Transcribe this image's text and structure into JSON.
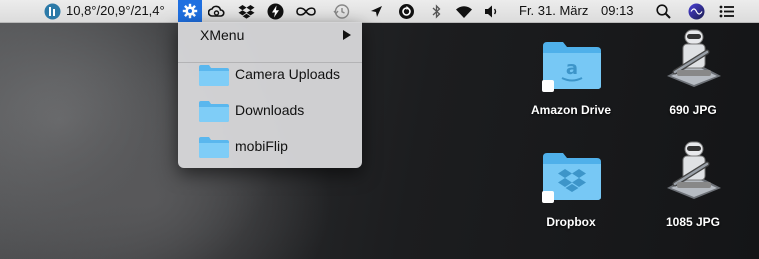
{
  "menubar": {
    "weather_text": "10,8°/20,9°/21,4°",
    "date": "Fr. 31. März",
    "time": "09:13",
    "status_icons": [
      "weather-app-icon",
      "gear-icon",
      "cloud-icon",
      "dropbox-icon",
      "bolt-icon",
      "infinity-icon",
      "time-machine-icon",
      "location-icon",
      "sync-icon",
      "bluetooth-icon",
      "wifi-icon",
      "volume-icon",
      "spotlight-icon",
      "siri-icon",
      "notification-center-icon"
    ]
  },
  "menu": {
    "title": "XMenu",
    "items": [
      {
        "label": "Camera Uploads"
      },
      {
        "label": "Downloads"
      },
      {
        "label": "mobiFlip"
      }
    ]
  },
  "desktop": {
    "icons": [
      {
        "label": "Amazon Drive",
        "kind": "folder"
      },
      {
        "label": "690 JPG",
        "kind": "automator"
      },
      {
        "label": "Dropbox",
        "kind": "folder"
      },
      {
        "label": "1085 JPG",
        "kind": "automator"
      }
    ]
  },
  "colors": {
    "accent": "#1f6fe0",
    "folder": "#6cc4f5"
  }
}
